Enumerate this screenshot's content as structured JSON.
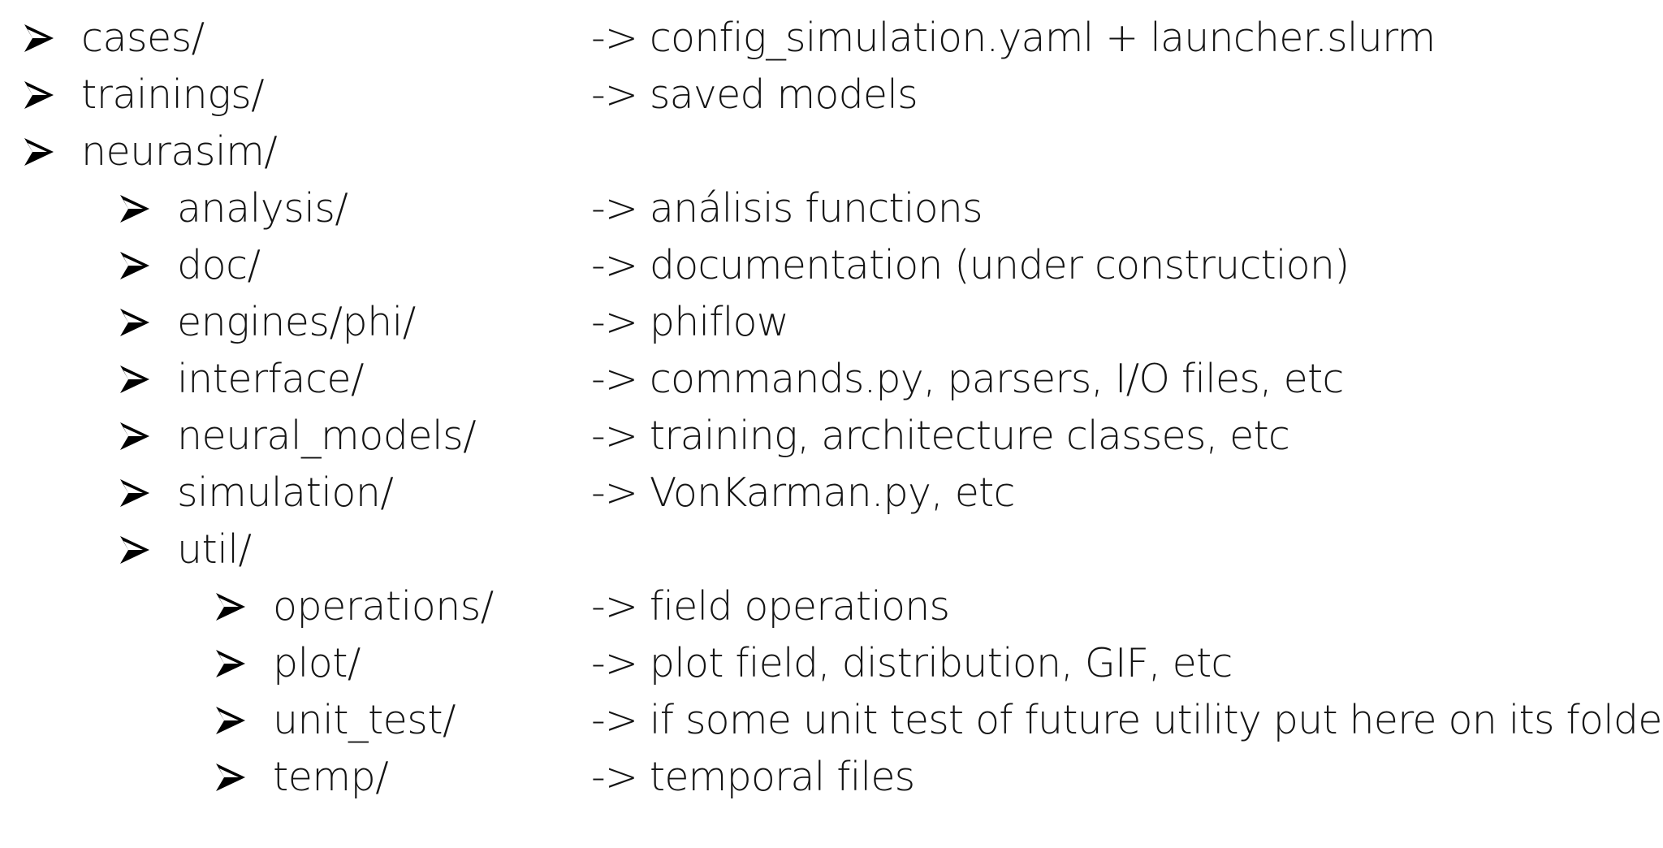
{
  "tree": {
    "items": [
      {
        "name": "cases/",
        "desc": "-> config_simulation.yaml + launcher.slurm",
        "icon": "arrowhead-bullet-icon"
      },
      {
        "name": "trainings/",
        "desc": "-> saved models",
        "icon": "arrowhead-bullet-icon"
      },
      {
        "name": "neurasim/",
        "desc": "",
        "icon": "arrowhead-bullet-icon"
      },
      {
        "name": "analysis/",
        "desc": "-> análisis functions",
        "icon": "arrowhead-bullet-icon"
      },
      {
        "name": "doc/",
        "desc": "-> documentation (under construction)",
        "icon": "arrowhead-bullet-icon"
      },
      {
        "name": "engines/phi/",
        "desc": "-> phiflow",
        "icon": "arrowhead-bullet-icon"
      },
      {
        "name": "interface/",
        "desc": "-> commands.py, parsers, I/O files, etc",
        "icon": "arrowhead-bullet-icon"
      },
      {
        "name": "neural_models/",
        "desc": "-> training, architecture classes, etc",
        "icon": "arrowhead-bullet-icon"
      },
      {
        "name": "simulation/",
        "desc": "-> VonKarman.py, etc",
        "icon": "arrowhead-bullet-icon"
      },
      {
        "name": "util/",
        "desc": "",
        "icon": "arrowhead-bullet-icon"
      },
      {
        "name": "operations/",
        "desc": "-> field operations",
        "icon": "arrowhead-bullet-icon"
      },
      {
        "name": "plot/",
        "desc": "-> plot field, distribution, GIF, etc",
        "icon": "arrowhead-bullet-icon"
      },
      {
        "name": "unit_test/",
        "desc": "-> if some unit test of future utility put here on its folder",
        "icon": "arrowhead-bullet-icon"
      },
      {
        "name": "temp/",
        "desc": "-> temporal files",
        "icon": "arrowhead-bullet-icon"
      }
    ]
  }
}
